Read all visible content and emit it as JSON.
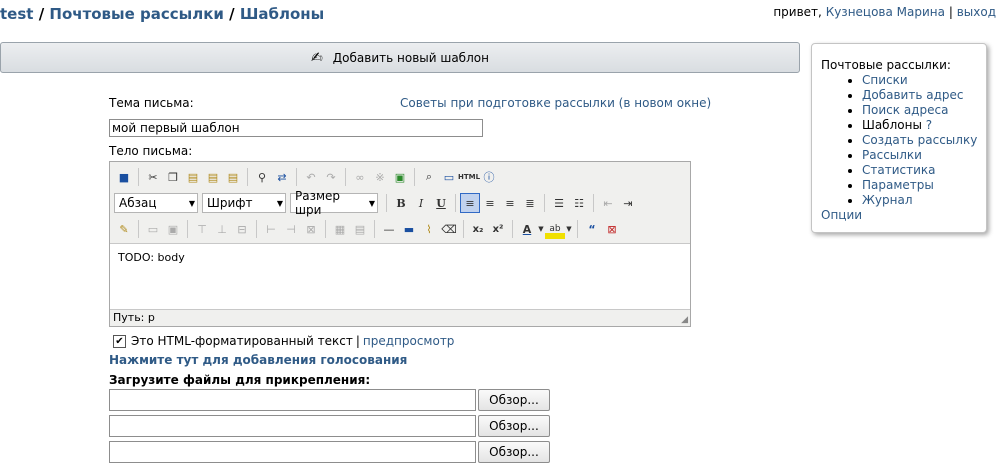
{
  "breadcrumb": {
    "root": "test",
    "section": "Почтовые рассылки",
    "current": "Шаблоны",
    "separator": "/"
  },
  "user": {
    "greeting": "привет,",
    "name": "Кузнецова Марина",
    "divider": "|",
    "logout": "выход"
  },
  "add_template": {
    "label": "Добавить новый шаблон",
    "icon": "pen-icon"
  },
  "sidebar": {
    "title": "Почтовые рассылки:",
    "items": [
      {
        "label": "Списки",
        "link": true
      },
      {
        "label": "Добавить адрес",
        "link": true
      },
      {
        "label": "Поиск адреса",
        "link": true
      },
      {
        "label": "Шаблоны",
        "link": false,
        "help": "?"
      },
      {
        "label": "Создать рассылку",
        "link": true
      },
      {
        "label": "Рассылки",
        "link": true
      },
      {
        "label": "Статистика",
        "link": true
      },
      {
        "label": "Параметры",
        "link": true
      },
      {
        "label": "Журнал",
        "link": true
      }
    ],
    "options": "Опции"
  },
  "form": {
    "subject_label": "Тема письма:",
    "tips_link": "Советы при подготовке рассылки (в новом окне)",
    "subject_value": "мой первый шаблон",
    "body_label": "Тело письма:"
  },
  "editor": {
    "format_select": "Абзац",
    "font_select": "Шрифт",
    "size_select": "Размер шри",
    "bold": "B",
    "italic": "I",
    "underline": "U",
    "content": "TODO: body",
    "path": "Путь: p"
  },
  "html_option": {
    "checked": true,
    "label": "Это HTML-форматированный текст",
    "divider": "|",
    "preview": "предпросмотр"
  },
  "vote_link": "Нажмите тут для добавления голосования",
  "attachments": {
    "label": "Загрузите файлы для прикрепления:",
    "browse": "Обзор..."
  }
}
